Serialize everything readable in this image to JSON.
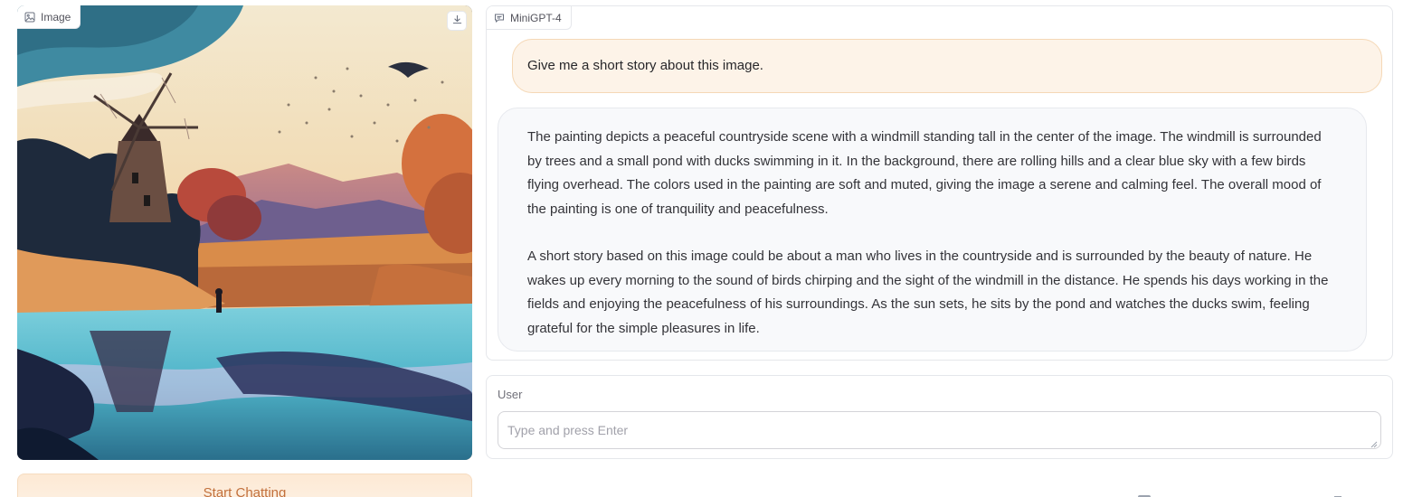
{
  "image_block": {
    "label": "Image",
    "label_icon": "image-icon",
    "download_icon": "download-icon"
  },
  "chatbot": {
    "label": "MiniGPT-4",
    "label_icon": "chat-bubble-icon",
    "messages": [
      {
        "role": "user",
        "text": "Give me a short story about this image."
      },
      {
        "role": "bot",
        "paragraphs": [
          "The painting depicts a peaceful countryside scene with a windmill standing tall in the center of the image. The windmill is surrounded by trees and a small pond with ducks swimming in it. In the background, there are rolling hills and a clear blue sky with a few birds flying overhead. The colors used in the painting are soft and muted, giving the image a serene and calming feel. The overall mood of the painting is one of tranquility and peacefulness.",
          "A short story based on this image could be about a man who lives in the countryside and is surrounded by the beauty of nature. He wakes up every morning to the sound of birds chirping and the sight of the windmill in the distance. He spends his days working in the fields and enjoying the peacefulness of his surroundings. As the sun sets, he sits by the pond and watches the ducks swim, feeling grateful for the simple pleasures in life."
        ]
      }
    ]
  },
  "user_input": {
    "label": "User",
    "placeholder": "Type and press Enter",
    "value": ""
  },
  "start_button": {
    "label": "Start Chatting"
  },
  "colors": {
    "accent": "#c2703c",
    "user_bubble": "#fdf3e8",
    "bot_bubble": "#f8f9fb",
    "border": "#e5e7eb"
  }
}
